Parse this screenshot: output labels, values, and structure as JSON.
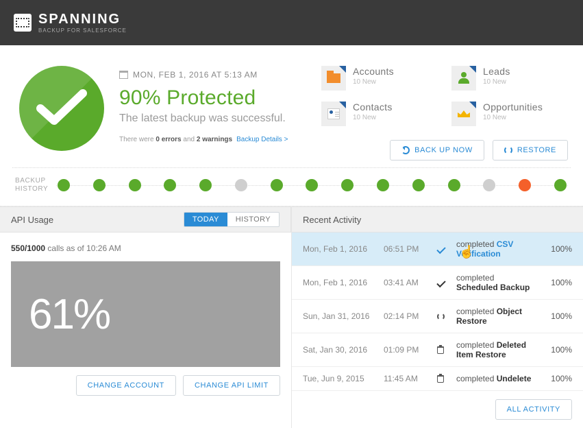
{
  "brand": {
    "name": "SPANNING",
    "tagline": "BACKUP FOR SALESFORCE"
  },
  "hero": {
    "datetime": "MON, FEB 1, 2016 AT 5:13 AM",
    "headline": "90% Protected",
    "subtitle": "The latest backup was successful.",
    "errline_prefix": "There were ",
    "errors": "0 errors",
    "errline_middle": " and ",
    "warnings": "2 warnings",
    "details_link": "Backup Details >"
  },
  "cards": [
    {
      "title": "Accounts",
      "sub": "10 New",
      "icon": "folder-icon"
    },
    {
      "title": "Leads",
      "sub": "10 New",
      "icon": "user-icon"
    },
    {
      "title": "Contacts",
      "sub": "10 New",
      "icon": "contact-card-icon"
    },
    {
      "title": "Opportunities",
      "sub": "10 New",
      "icon": "crown-icon"
    }
  ],
  "actions": {
    "backup": "BACK UP NOW",
    "restore": "RESTORE"
  },
  "history": {
    "label_l1": "BACKUP",
    "label_l2": "HISTORY",
    "dots": [
      "#5aaa2b",
      "#5aaa2b",
      "#5aaa2b",
      "#5aaa2b",
      "#5aaa2b",
      "#cfcfcf",
      "#5aaa2b",
      "#5aaa2b",
      "#5aaa2b",
      "#5aaa2b",
      "#5aaa2b",
      "#5aaa2b",
      "#cfcfcf",
      "#f4602a",
      "#5aaa2b"
    ]
  },
  "api_panel": {
    "title": "API Usage",
    "tab_today": "TODAY",
    "tab_history": "HISTORY",
    "calls_count": "550/1000",
    "calls_text": "calls as of 10:26 AM",
    "usage_pct": "61%",
    "btn_change_account": "CHANGE ACCOUNT",
    "btn_change_limit": "CHANGE API LIMIT"
  },
  "activity_panel": {
    "title": "Recent Activity",
    "btn_all": "ALL ACTIVITY",
    "rows": [
      {
        "date": "Mon, Feb 1, 2016",
        "time": "06:51 PM",
        "icon": "check",
        "verb": "completed ",
        "name": "CSV Verification",
        "pct": "100%",
        "hl": true
      },
      {
        "date": "Mon, Feb 1, 2016",
        "time": "03:41 AM",
        "icon": "check",
        "verb": "completed ",
        "name": "Scheduled Backup",
        "pct": "100%"
      },
      {
        "date": "Sun, Jan 31, 2016",
        "time": "02:14 PM",
        "icon": "swap",
        "verb": "completed ",
        "name": "Object Restore",
        "pct": "100%"
      },
      {
        "date": "Sat, Jan 30, 2016",
        "time": "01:09 PM",
        "icon": "trash",
        "verb": "completed ",
        "name": "Deleted Item Restore",
        "pct": "100%"
      },
      {
        "date": "Tue, Jun 9, 2015",
        "time": "11:45 AM",
        "icon": "trash",
        "verb": "completed ",
        "name": "Undelete",
        "pct": "100%"
      }
    ]
  },
  "colors": {
    "green": "#5aaa2b",
    "blue": "#2a8bd5",
    "orange": "#f4602a",
    "gray": "#cfcfcf"
  }
}
